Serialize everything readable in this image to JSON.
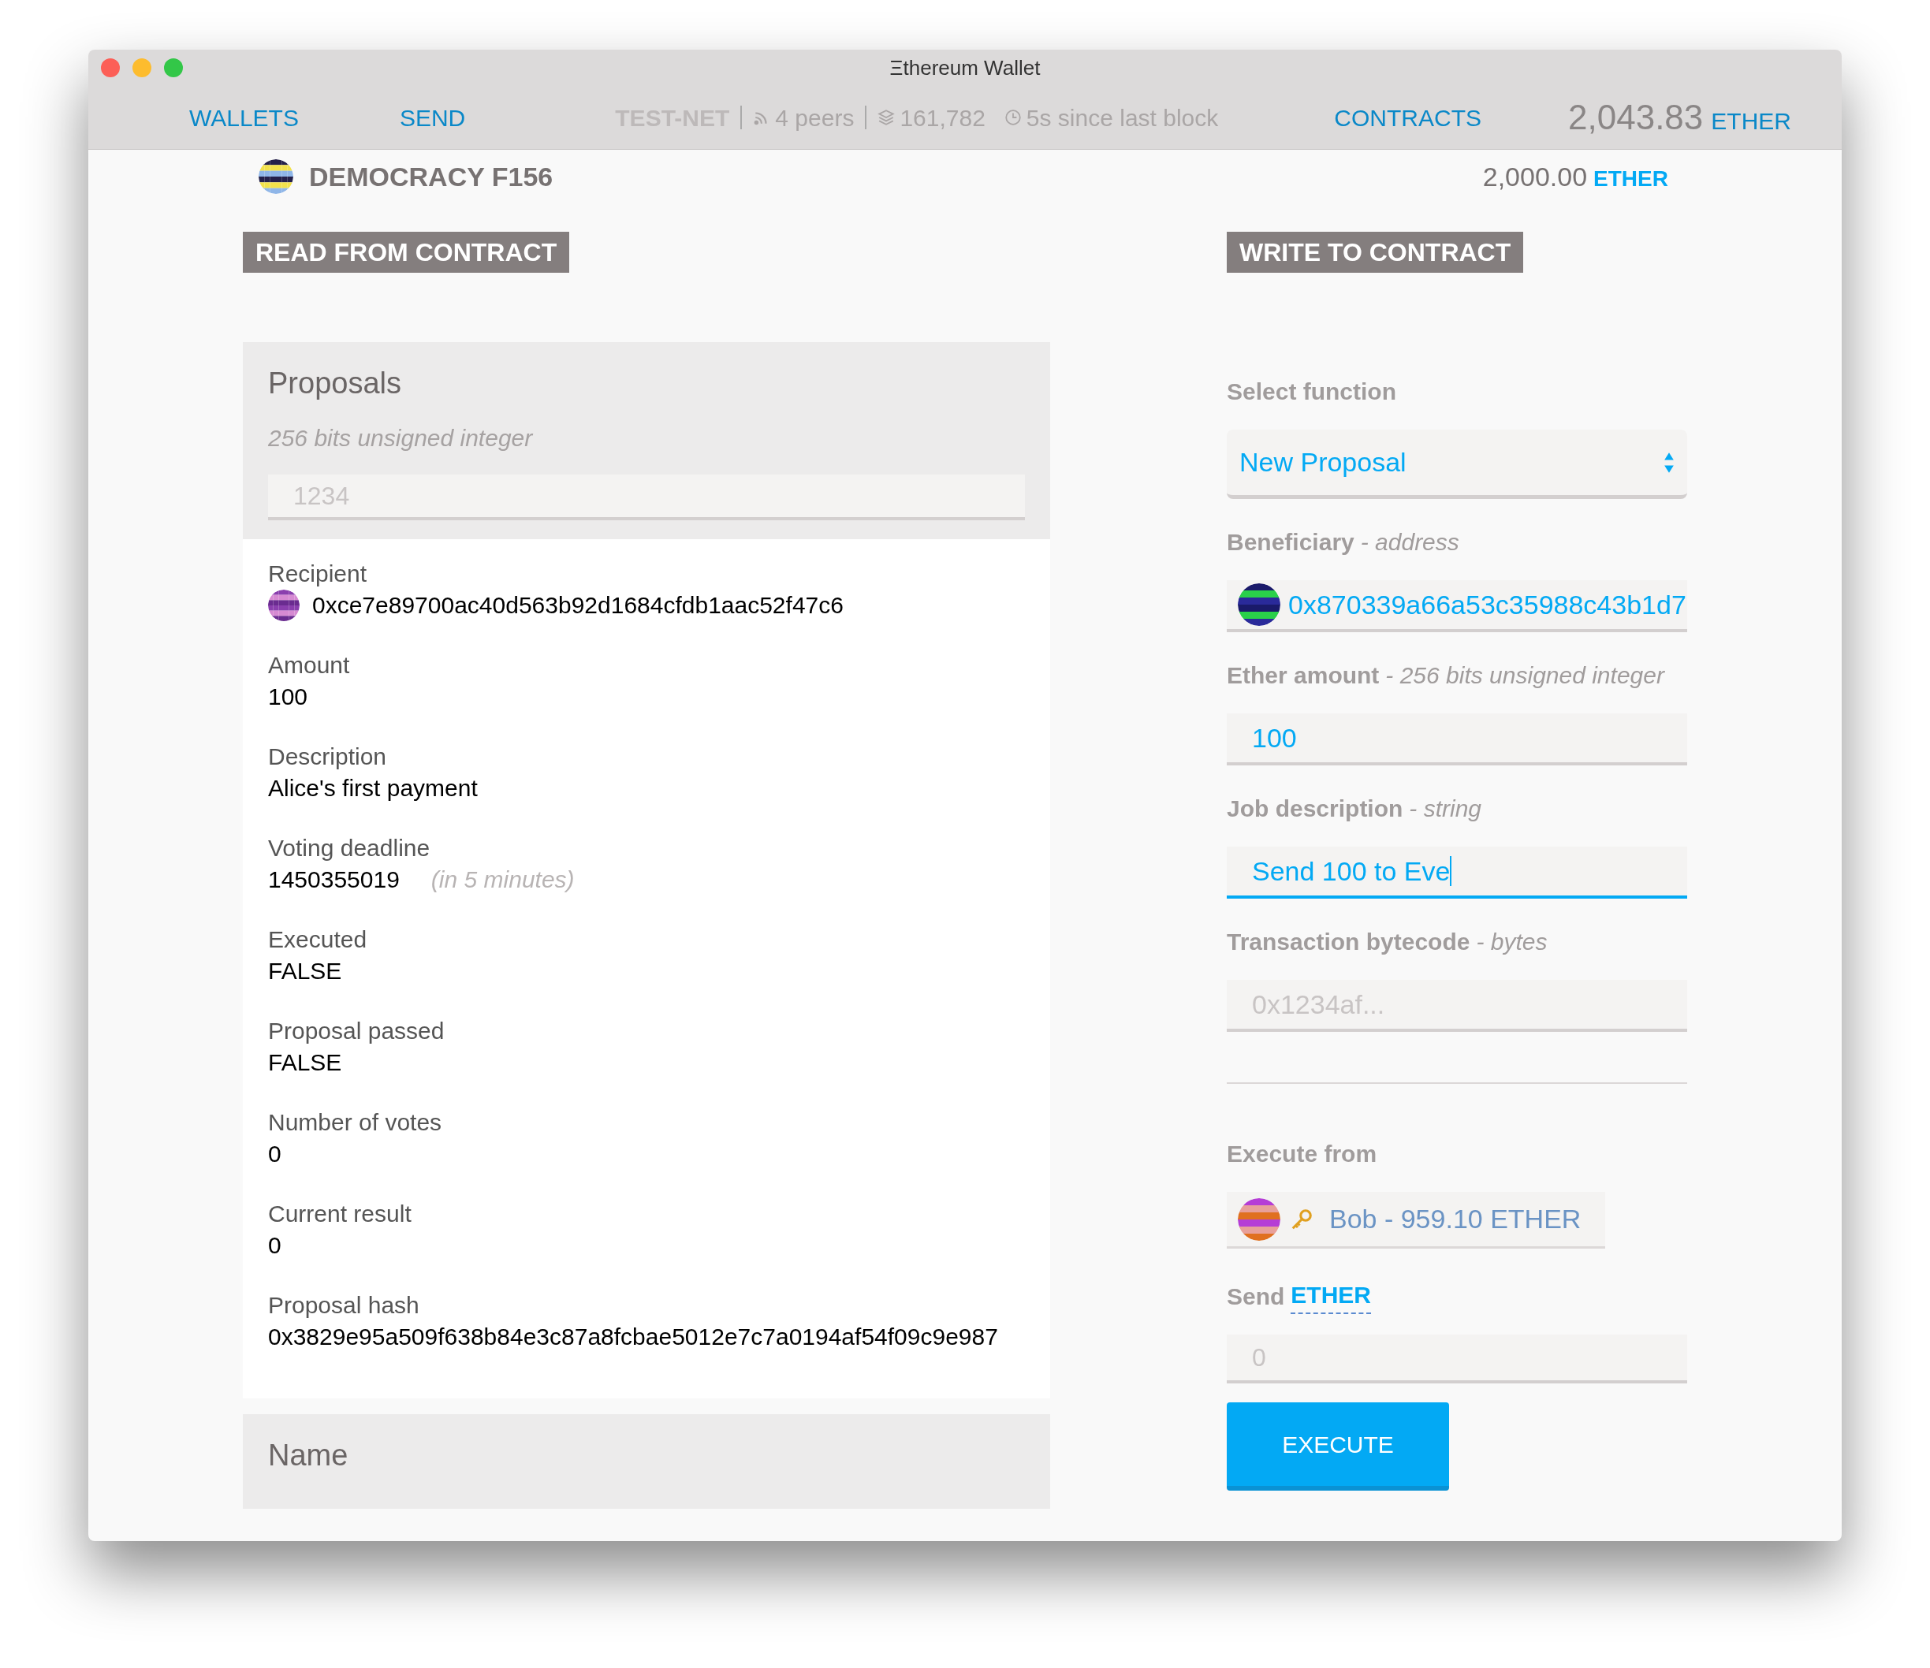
{
  "window": {
    "title": "Ξthereum Wallet"
  },
  "nav": {
    "items": [
      {
        "label": "WALLETS"
      },
      {
        "label": "SEND"
      }
    ],
    "status": {
      "network": "TEST-NET",
      "peers": "4 peers",
      "block": "161,782",
      "since": "5s since last block"
    },
    "contracts": "CONTRACTS",
    "balance": {
      "amount": "2,043.83",
      "unit": "ETHER"
    }
  },
  "contract": {
    "name": "DEMOCRACY F156",
    "balance": "2,000.00",
    "unit": "ETHER"
  },
  "read": {
    "title": "READ FROM CONTRACT",
    "query": {
      "label": "Proposals",
      "type": "256 bits unsigned integer",
      "placeholder": "1234"
    },
    "results": [
      {
        "label": "Recipient",
        "value": "0xce7e89700ac40d563b92d1684cfdb1aac52f47c6",
        "avatar": true
      },
      {
        "label": "Amount",
        "value": "100",
        "avatar": false
      },
      {
        "label": "Description",
        "value": "Alice's first payment",
        "avatar": false
      },
      {
        "label": "Voting deadline",
        "value": "1450355019",
        "note": "(in 5 minutes)",
        "avatar": false
      },
      {
        "label": "Executed",
        "value": "FALSE",
        "avatar": false
      },
      {
        "label": "Proposal passed",
        "value": "FALSE",
        "avatar": false
      },
      {
        "label": "Number of votes",
        "value": "0",
        "avatar": false
      },
      {
        "label": "Current result",
        "value": "0",
        "avatar": false
      },
      {
        "label": "Proposal hash",
        "value": "0x3829e95a509f638b84e3c87a8fcbae5012e7c7a0194af54f09c9e987",
        "avatar": false
      }
    ],
    "next": {
      "label": "Name"
    }
  },
  "write": {
    "title": "WRITE TO CONTRACT",
    "select_label": "Select function",
    "function": "New Proposal",
    "params": [
      {
        "kind": "address",
        "label": "Beneficiary",
        "type": "- address",
        "value": "0x870339a66a53c35988c43b1d7",
        "focused": false
      },
      {
        "kind": "text",
        "label": "Ether amount",
        "type": "- 256 bits unsigned integer",
        "value": "100",
        "focused": false
      },
      {
        "kind": "text",
        "label": "Job description",
        "type": "- string",
        "value": "Send 100 to Eve",
        "focused": true
      },
      {
        "kind": "text",
        "label": "Transaction bytecode",
        "type": "- bytes",
        "placeholder": "0x1234af...",
        "focused": false
      }
    ],
    "execute_from": {
      "label": "Execute from",
      "account": "Bob - 959.10 ETHER"
    },
    "send": {
      "label": "Send",
      "unit": "ETHER",
      "placeholder": "0"
    },
    "button": "EXECUTE"
  }
}
